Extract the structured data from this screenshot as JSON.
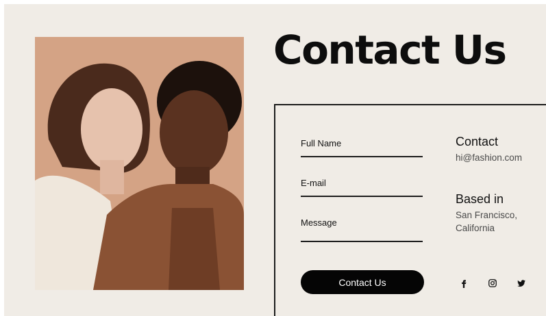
{
  "page": {
    "title": "Contact Us"
  },
  "form": {
    "full_name_label": "Full Name",
    "email_label": "E-mail",
    "message_label": "Message",
    "submit_label": "Contact Us"
  },
  "contact_info": {
    "contact_heading": "Contact",
    "email": "hi@fashion.com",
    "location_heading": "Based in",
    "location": "San Francisco, California"
  },
  "socials": [
    {
      "icon": "facebook-icon"
    },
    {
      "icon": "instagram-icon"
    },
    {
      "icon": "twitter-icon"
    }
  ],
  "colors": {
    "background": "#f0ece6",
    "text": "#111111",
    "button": "#050505",
    "photo_backdrop": "#d2a183"
  }
}
